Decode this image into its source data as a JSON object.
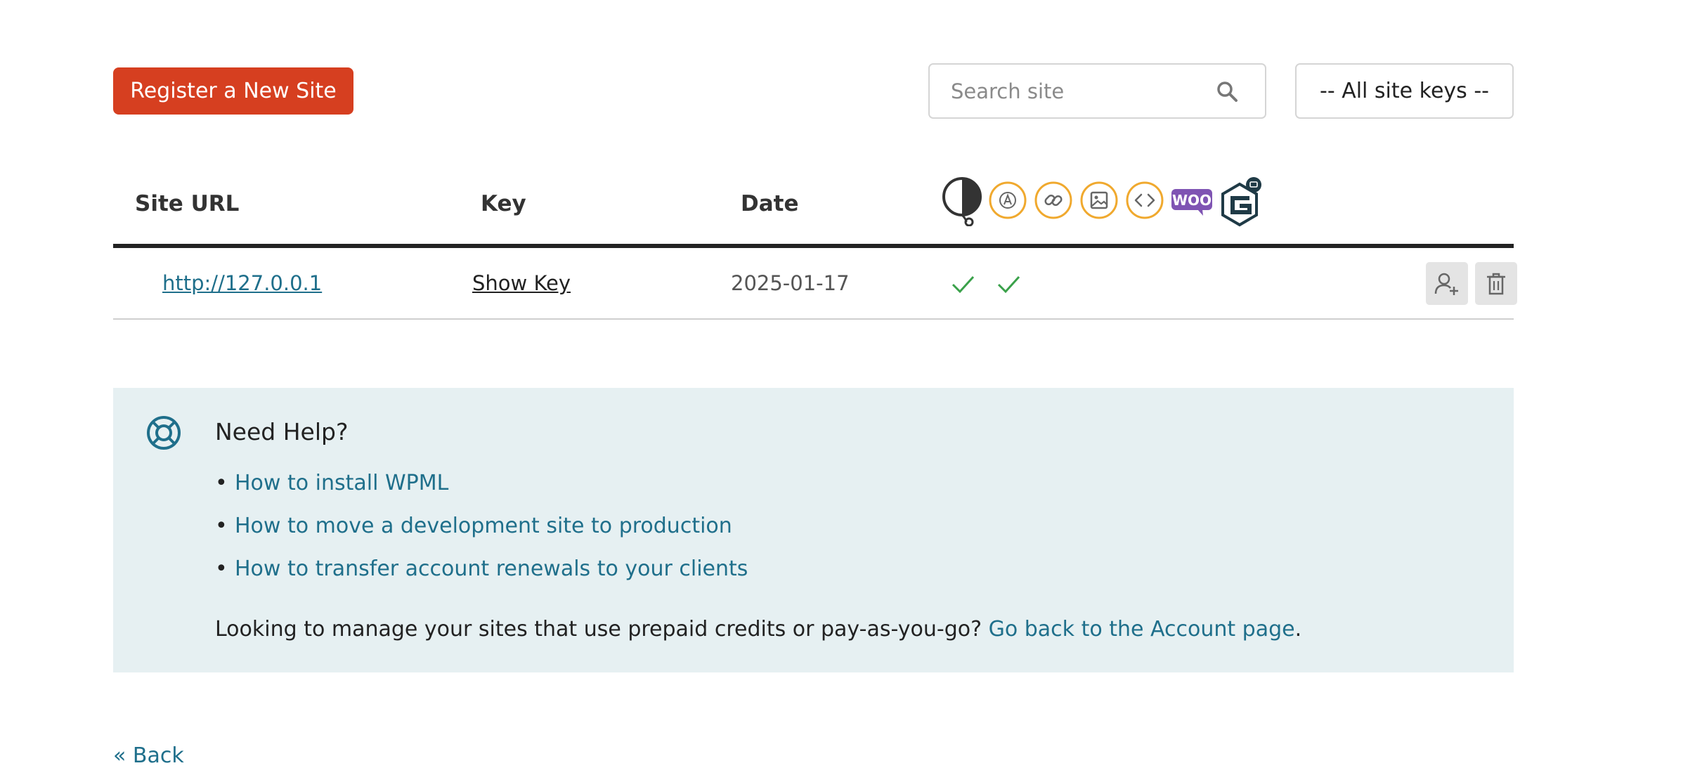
{
  "toolbar": {
    "register_label": "Register a New Site",
    "search_placeholder": "Search site",
    "keys_filter": "-- All site keys --"
  },
  "table": {
    "columns": [
      "Site URL",
      "Key",
      "Date"
    ],
    "feature_icons": [
      "support-headset-icon",
      "automatic-translation-icon",
      "link-icon",
      "image-icon",
      "code-icon",
      "woo-icon",
      "gravity-forms-icon"
    ],
    "rows": [
      {
        "site_url": "http://127.0.0.1",
        "key": "Show Key",
        "date": "2025-01-17",
        "checks": 2
      }
    ]
  },
  "woo_text": "WOO",
  "help": {
    "title": "Need Help?",
    "links": [
      "How to install WPML",
      "How to move a development site to production",
      "How to transfer account renewals to your clients"
    ],
    "note_text": "Looking to manage your sites that use prepaid credits or pay-as-you-go?",
    "note_link": "Go back to the Account page",
    "note_end": "."
  },
  "back_label": "« Back",
  "colors": {
    "primary_button": "#d63f20",
    "link": "#1f6f8b",
    "help_bg": "#e6f0f2",
    "icon_orange": "#f0a92e",
    "check_green": "#3aa14a",
    "woo_purple": "#7f54b3",
    "gravity_dark": "#1f3a46"
  }
}
